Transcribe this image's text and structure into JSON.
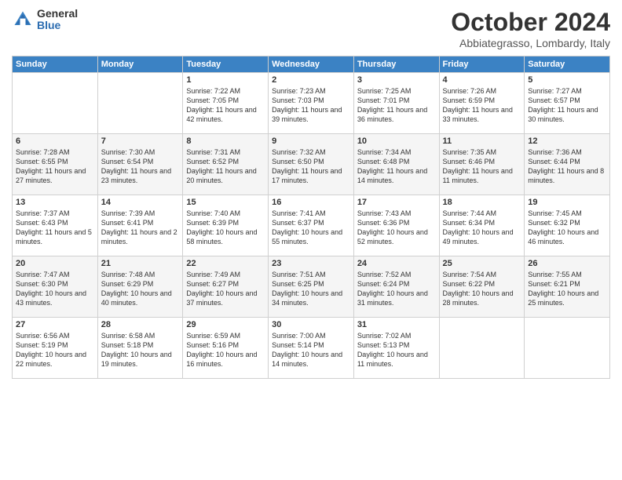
{
  "header": {
    "logo_general": "General",
    "logo_blue": "Blue",
    "month_title": "October 2024",
    "location": "Abbiategrasso, Lombardy, Italy"
  },
  "weekdays": [
    "Sunday",
    "Monday",
    "Tuesday",
    "Wednesday",
    "Thursday",
    "Friday",
    "Saturday"
  ],
  "weeks": [
    [
      {
        "day": "",
        "sunrise": "",
        "sunset": "",
        "daylight": ""
      },
      {
        "day": "",
        "sunrise": "",
        "sunset": "",
        "daylight": ""
      },
      {
        "day": "1",
        "sunrise": "Sunrise: 7:22 AM",
        "sunset": "Sunset: 7:05 PM",
        "daylight": "Daylight: 11 hours and 42 minutes."
      },
      {
        "day": "2",
        "sunrise": "Sunrise: 7:23 AM",
        "sunset": "Sunset: 7:03 PM",
        "daylight": "Daylight: 11 hours and 39 minutes."
      },
      {
        "day": "3",
        "sunrise": "Sunrise: 7:25 AM",
        "sunset": "Sunset: 7:01 PM",
        "daylight": "Daylight: 11 hours and 36 minutes."
      },
      {
        "day": "4",
        "sunrise": "Sunrise: 7:26 AM",
        "sunset": "Sunset: 6:59 PM",
        "daylight": "Daylight: 11 hours and 33 minutes."
      },
      {
        "day": "5",
        "sunrise": "Sunrise: 7:27 AM",
        "sunset": "Sunset: 6:57 PM",
        "daylight": "Daylight: 11 hours and 30 minutes."
      }
    ],
    [
      {
        "day": "6",
        "sunrise": "Sunrise: 7:28 AM",
        "sunset": "Sunset: 6:55 PM",
        "daylight": "Daylight: 11 hours and 27 minutes."
      },
      {
        "day": "7",
        "sunrise": "Sunrise: 7:30 AM",
        "sunset": "Sunset: 6:54 PM",
        "daylight": "Daylight: 11 hours and 23 minutes."
      },
      {
        "day": "8",
        "sunrise": "Sunrise: 7:31 AM",
        "sunset": "Sunset: 6:52 PM",
        "daylight": "Daylight: 11 hours and 20 minutes."
      },
      {
        "day": "9",
        "sunrise": "Sunrise: 7:32 AM",
        "sunset": "Sunset: 6:50 PM",
        "daylight": "Daylight: 11 hours and 17 minutes."
      },
      {
        "day": "10",
        "sunrise": "Sunrise: 7:34 AM",
        "sunset": "Sunset: 6:48 PM",
        "daylight": "Daylight: 11 hours and 14 minutes."
      },
      {
        "day": "11",
        "sunrise": "Sunrise: 7:35 AM",
        "sunset": "Sunset: 6:46 PM",
        "daylight": "Daylight: 11 hours and 11 minutes."
      },
      {
        "day": "12",
        "sunrise": "Sunrise: 7:36 AM",
        "sunset": "Sunset: 6:44 PM",
        "daylight": "Daylight: 11 hours and 8 minutes."
      }
    ],
    [
      {
        "day": "13",
        "sunrise": "Sunrise: 7:37 AM",
        "sunset": "Sunset: 6:43 PM",
        "daylight": "Daylight: 11 hours and 5 minutes."
      },
      {
        "day": "14",
        "sunrise": "Sunrise: 7:39 AM",
        "sunset": "Sunset: 6:41 PM",
        "daylight": "Daylight: 11 hours and 2 minutes."
      },
      {
        "day": "15",
        "sunrise": "Sunrise: 7:40 AM",
        "sunset": "Sunset: 6:39 PM",
        "daylight": "Daylight: 10 hours and 58 minutes."
      },
      {
        "day": "16",
        "sunrise": "Sunrise: 7:41 AM",
        "sunset": "Sunset: 6:37 PM",
        "daylight": "Daylight: 10 hours and 55 minutes."
      },
      {
        "day": "17",
        "sunrise": "Sunrise: 7:43 AM",
        "sunset": "Sunset: 6:36 PM",
        "daylight": "Daylight: 10 hours and 52 minutes."
      },
      {
        "day": "18",
        "sunrise": "Sunrise: 7:44 AM",
        "sunset": "Sunset: 6:34 PM",
        "daylight": "Daylight: 10 hours and 49 minutes."
      },
      {
        "day": "19",
        "sunrise": "Sunrise: 7:45 AM",
        "sunset": "Sunset: 6:32 PM",
        "daylight": "Daylight: 10 hours and 46 minutes."
      }
    ],
    [
      {
        "day": "20",
        "sunrise": "Sunrise: 7:47 AM",
        "sunset": "Sunset: 6:30 PM",
        "daylight": "Daylight: 10 hours and 43 minutes."
      },
      {
        "day": "21",
        "sunrise": "Sunrise: 7:48 AM",
        "sunset": "Sunset: 6:29 PM",
        "daylight": "Daylight: 10 hours and 40 minutes."
      },
      {
        "day": "22",
        "sunrise": "Sunrise: 7:49 AM",
        "sunset": "Sunset: 6:27 PM",
        "daylight": "Daylight: 10 hours and 37 minutes."
      },
      {
        "day": "23",
        "sunrise": "Sunrise: 7:51 AM",
        "sunset": "Sunset: 6:25 PM",
        "daylight": "Daylight: 10 hours and 34 minutes."
      },
      {
        "day": "24",
        "sunrise": "Sunrise: 7:52 AM",
        "sunset": "Sunset: 6:24 PM",
        "daylight": "Daylight: 10 hours and 31 minutes."
      },
      {
        "day": "25",
        "sunrise": "Sunrise: 7:54 AM",
        "sunset": "Sunset: 6:22 PM",
        "daylight": "Daylight: 10 hours and 28 minutes."
      },
      {
        "day": "26",
        "sunrise": "Sunrise: 7:55 AM",
        "sunset": "Sunset: 6:21 PM",
        "daylight": "Daylight: 10 hours and 25 minutes."
      }
    ],
    [
      {
        "day": "27",
        "sunrise": "Sunrise: 6:56 AM",
        "sunset": "Sunset: 5:19 PM",
        "daylight": "Daylight: 10 hours and 22 minutes."
      },
      {
        "day": "28",
        "sunrise": "Sunrise: 6:58 AM",
        "sunset": "Sunset: 5:18 PM",
        "daylight": "Daylight: 10 hours and 19 minutes."
      },
      {
        "day": "29",
        "sunrise": "Sunrise: 6:59 AM",
        "sunset": "Sunset: 5:16 PM",
        "daylight": "Daylight: 10 hours and 16 minutes."
      },
      {
        "day": "30",
        "sunrise": "Sunrise: 7:00 AM",
        "sunset": "Sunset: 5:14 PM",
        "daylight": "Daylight: 10 hours and 14 minutes."
      },
      {
        "day": "31",
        "sunrise": "Sunrise: 7:02 AM",
        "sunset": "Sunset: 5:13 PM",
        "daylight": "Daylight: 10 hours and 11 minutes."
      },
      {
        "day": "",
        "sunrise": "",
        "sunset": "",
        "daylight": ""
      },
      {
        "day": "",
        "sunrise": "",
        "sunset": "",
        "daylight": ""
      }
    ]
  ]
}
